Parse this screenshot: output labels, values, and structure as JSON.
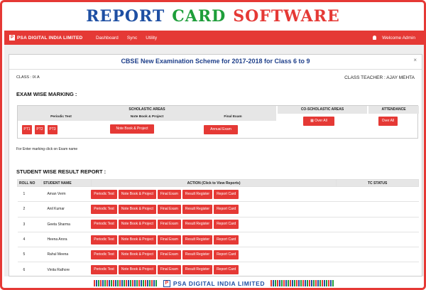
{
  "banner": {
    "word1": "REPORT",
    "word2": "CARD",
    "word3": "SOFTWARE"
  },
  "nav": {
    "brand_mark": "P",
    "brand": "PSA DIGITAL INDIA LIMITED",
    "items": [
      "Dashboard",
      "Sync",
      "Utility"
    ],
    "user": "Welcome Admin"
  },
  "modal": {
    "title": "CBSE New Examination Scheme for 2017-2018 for Class 6 to 9",
    "close": "×",
    "class_label": "CLASS : IX A",
    "teacher_label": "CLASS TEACHER : AJAY MEHTA"
  },
  "exam": {
    "heading": "EXAM WISE MARKING :",
    "scholastic": "SCHOLASTIC AREAS",
    "co_scholastic": "CO-SCHOLASTIC AREAS",
    "attendance": "ATTENDANCE",
    "periodic_test": "Periodic Test",
    "notebook": "Note Book & Project",
    "final_exam": "Final Exam",
    "pt_buttons": [
      "PT1",
      "PT2",
      "PT3"
    ],
    "notebook_btn": "Note Book & Project",
    "annual_btn": "Annual Exam",
    "co_btn": "Over All",
    "att_btn": "Over All",
    "note": "For Enter marking click on Exam name"
  },
  "results": {
    "heading": "STUDENT WISE RESULT REPORT :",
    "columns": [
      "ROLL NO",
      "STUDENT NAME",
      "ACTION (Click to View Reports)",
      "TC STATUS"
    ],
    "actions": [
      "Periodic Test",
      "Note Book & Project",
      "Final Exam",
      "Result Register",
      "Report Card"
    ],
    "rows": [
      {
        "roll": "1",
        "name": "Aman Verm"
      },
      {
        "roll": "2",
        "name": "Anil Kumar"
      },
      {
        "roll": "3",
        "name": "Geeta Sharma"
      },
      {
        "roll": "4",
        "name": "Heena Arora"
      },
      {
        "roll": "5",
        "name": "Rahul Meena"
      },
      {
        "roll": "6",
        "name": "Vinita Rathore"
      }
    ]
  },
  "footer": {
    "mark": "P",
    "text": "PSA DIGITAL INDIA LIMITED"
  },
  "colors": {
    "accent": "#e53935",
    "brand_blue": "#1e4fa3",
    "brand_green": "#1e9e3a"
  }
}
